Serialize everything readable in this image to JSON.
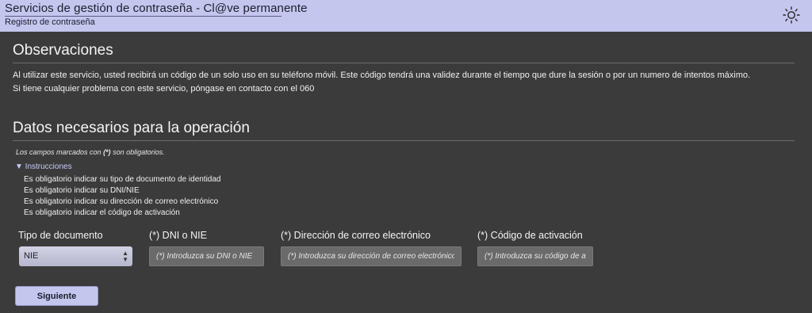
{
  "header": {
    "title": "Servicios de gestión de contraseña - Cl@ve permanente",
    "subtitle": "Registro de contraseña",
    "theme_icon": "sun-icon"
  },
  "observations": {
    "title": "Observaciones",
    "line1": "Al utilizar este servicio, usted recibirá un código de un solo uso en su teléfono móvil. Este código tendrá una validez durante el tiempo que dure la sesión o por un numero de intentos máximo.",
    "line2": "Si tiene cualquier problema con este servicio, póngase en contacto con el 060"
  },
  "operation": {
    "title": "Datos necesarios para la operación",
    "required_note_pre": "Los campos marcados con ",
    "required_note_mark": "(*)",
    "required_note_post": " son obligatorios.",
    "instructions_label": "▼ Instrucciones",
    "instructions": [
      "Es obligatorio indicar su tipo de documento de identidad",
      "Es obligatorio indicar su DNI/NIE",
      "Es obligatorio indicar su dirección de correo electrónico",
      "Es obligatorio indicar el código de activación"
    ]
  },
  "form": {
    "doc_type_label": "Tipo de documento",
    "doc_type_value": "NIE",
    "dni_label": "(*) DNI o NIE",
    "dni_placeholder": "(*) Introduzca su DNI o NIE",
    "email_label": "(*) Dirección de correo electrónico",
    "email_placeholder": "(*) Introduzca su dirección de correo electrónico",
    "code_label": "(*) Código de activación",
    "code_placeholder": "(*) Introduzca su código de activación",
    "submit_label": "Siguiente"
  }
}
